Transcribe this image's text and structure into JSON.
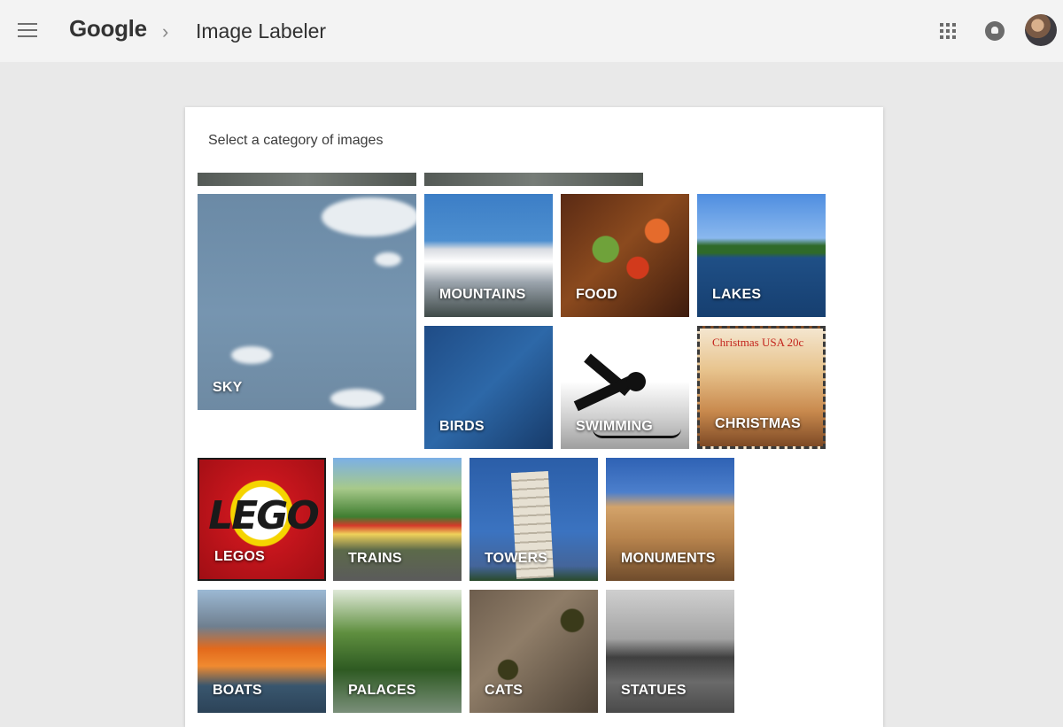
{
  "header": {
    "logo": "Google",
    "separator": "›",
    "app_title": "Image Labeler"
  },
  "card": {
    "heading": "Select a category of images"
  },
  "categories": [
    {
      "label": "SKY"
    },
    {
      "label": "MOUNTAINS"
    },
    {
      "label": "FOOD"
    },
    {
      "label": "LAKES"
    },
    {
      "label": "BIRDS"
    },
    {
      "label": "SWIMMING"
    },
    {
      "label": "CHRISTMAS"
    },
    {
      "label": "LEGOS"
    },
    {
      "label": "TRAINS"
    },
    {
      "label": "TOWERS"
    },
    {
      "label": "MONUMENTS"
    },
    {
      "label": "BOATS"
    },
    {
      "label": "PALACES"
    },
    {
      "label": "CATS"
    },
    {
      "label": "STATUES"
    }
  ],
  "image_text": {
    "lego_logo": "LEGO",
    "christmas_stamp": "Christmas USA 20c"
  },
  "icons": {
    "menu": "hamburger-menu-icon",
    "apps": "apps-grid-icon",
    "notifications": "notifications-bell-icon",
    "account": "account-avatar"
  }
}
